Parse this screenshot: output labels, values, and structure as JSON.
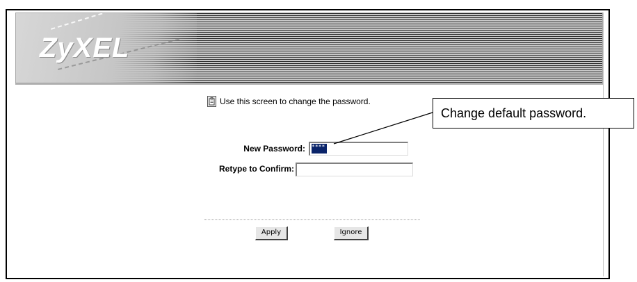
{
  "banner": {
    "logo_text": "ZyXEL"
  },
  "hint": {
    "icon": "note-icon",
    "text": "Use this screen to change the password."
  },
  "form": {
    "new_password_label": "New Password:",
    "new_password_value": "****",
    "retype_label": "Retype to Confirm:",
    "retype_value": ""
  },
  "buttons": {
    "apply": "Apply",
    "ignore": "Ignore"
  },
  "callout": {
    "text": "Change default password."
  }
}
